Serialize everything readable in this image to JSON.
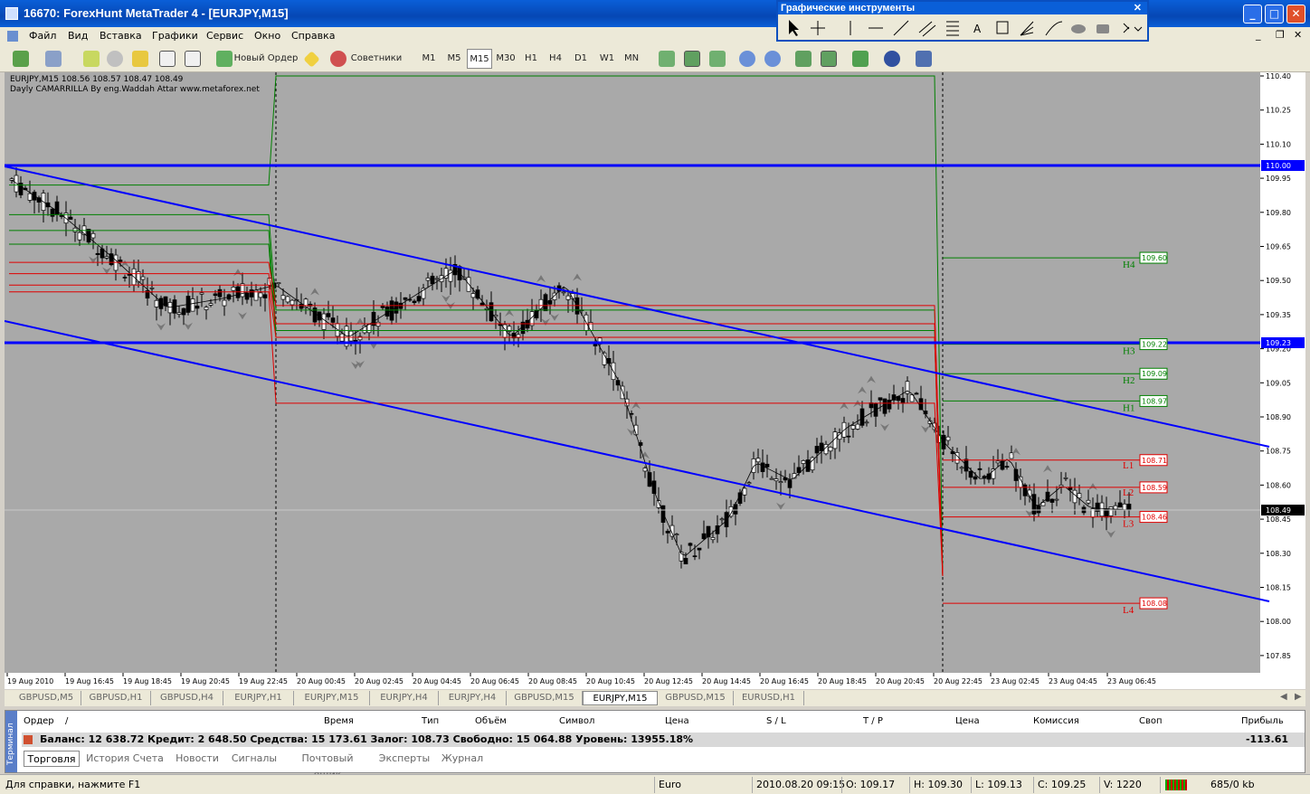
{
  "window": {
    "title": "16670: ForexHunt MetaTrader 4 - [EURJPY,M15]"
  },
  "menu": [
    "Файл",
    "Вид",
    "Вставка",
    "Графики",
    "Сервис",
    "Окно",
    "Справка"
  ],
  "toolbar": {
    "new_order": "Новый Ордер",
    "experts": "Советники",
    "timeframes": [
      "M1",
      "M5",
      "M15",
      "M30",
      "H1",
      "H4",
      "D1",
      "W1",
      "MN"
    ],
    "active_timeframe": "M15"
  },
  "drawing_tools": {
    "title": "Графические инструменты",
    "text_a": "A"
  },
  "chart": {
    "symbol_line": "EURJPY,M15  108.56 108.57 108.47 108.49",
    "indicator_line": "Dayly CAMARRILLA By eng.Waddah Attar www.metaforex.net",
    "price_labels": [
      "110.40",
      "110.25",
      "110.10",
      "109.95",
      "109.80",
      "109.65",
      "109.50",
      "109.35",
      "109.20",
      "109.05",
      "108.90",
      "108.75",
      "108.60",
      "108.45",
      "108.30",
      "108.15",
      "108.00",
      "107.85"
    ],
    "time_labels": [
      "19 Aug 2010",
      "19 Aug 16:45",
      "19 Aug 18:45",
      "19 Aug 20:45",
      "19 Aug 22:45",
      "20 Aug 00:45",
      "20 Aug 02:45",
      "20 Aug 04:45",
      "20 Aug 06:45",
      "20 Aug 08:45",
      "20 Aug 10:45",
      "20 Aug 12:45",
      "20 Aug 14:45",
      "20 Aug 16:45",
      "20 Aug 18:45",
      "20 Aug 20:45",
      "20 Aug 22:45",
      "23 Aug 02:45",
      "23 Aug 04:45",
      "23 Aug 06:45"
    ],
    "highlight_prices": {
      "upper": "110.00",
      "lower": "109.23",
      "current": "108.49"
    },
    "pivots": [
      {
        "name": "H4",
        "value": "109.60",
        "color": "#008000"
      },
      {
        "name": "H3",
        "value": "109.22",
        "color": "#008000"
      },
      {
        "name": "H2",
        "value": "109.09",
        "color": "#008000"
      },
      {
        "name": "H1",
        "value": "108.97",
        "color": "#008000"
      },
      {
        "name": "L1",
        "value": "108.71",
        "color": "#e00000"
      },
      {
        "name": "L2",
        "value": "108.59",
        "color": "#e00000"
      },
      {
        "name": "L3",
        "value": "108.46",
        "color": "#e00000"
      },
      {
        "name": "L4",
        "value": "108.08",
        "color": "#e00000"
      }
    ],
    "colors": {
      "background": "#a9a9a9",
      "channel": "#0000ff",
      "bull": "#ffffff",
      "bear": "#000000"
    }
  },
  "symbol_tabs": [
    "GBPUSD,M5",
    "GBPUSD,H1",
    "GBPUSD,H4",
    "EURJPY,H1",
    "EURJPY,M15",
    "EURJPY,H4",
    "EURJPY,H4",
    "GBPUSD,M15",
    "EURJPY,M15",
    "GBPUSD,M15",
    "EURUSD,H1"
  ],
  "active_symbol_tab": "EURJPY,M15",
  "terminal": {
    "side_label": "Терминал",
    "columns": [
      "Ордер",
      "/",
      "Время",
      "Тип",
      "Объём",
      "Символ",
      "Цена",
      "S / L",
      "T / P",
      "Цена",
      "Комиссия",
      "Своп",
      "Прибыль"
    ],
    "balance": "Баланс: 12 638.72  Кредит: 2 648.50  Средства: 15 173.61  Залог: 108.73  Свободно: 15 064.88  Уровень: 13955.18%",
    "profit": "-113.61",
    "tabs": [
      "Торговля",
      "История Счета",
      "Новости",
      "Сигналы",
      "Почтовый ящик",
      "Эксперты",
      "Журнал"
    ]
  },
  "status": {
    "help": "Для справки, нажмите F1",
    "profile": "Euro",
    "time": "2010.08.20 09:15",
    "open": "O: 109.17",
    "high": "H: 109.30",
    "low": "L: 109.13",
    "close": "C: 109.25",
    "volume": "V: 1220",
    "traffic": "685/0 kb"
  }
}
